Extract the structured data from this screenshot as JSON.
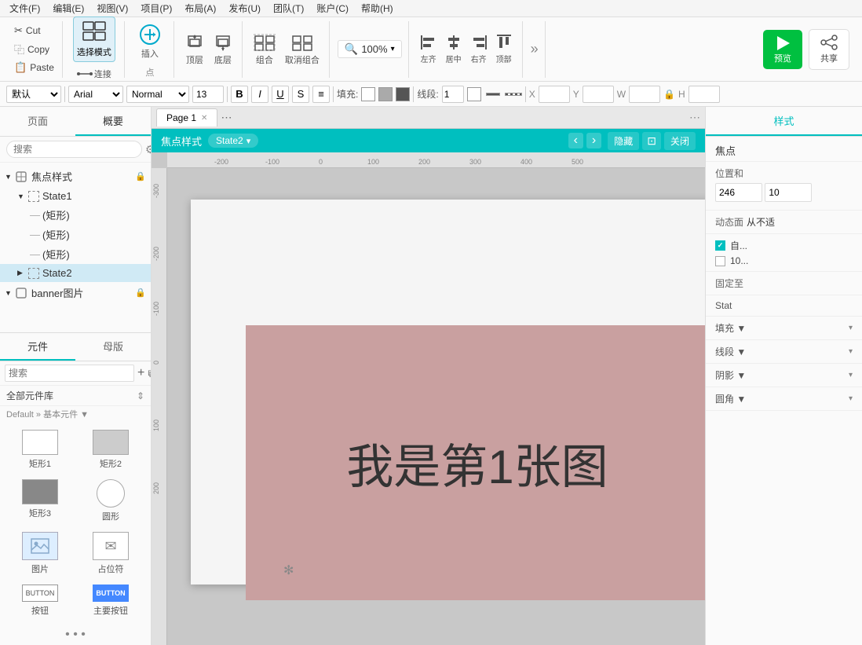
{
  "menubar": {
    "items": [
      "文件(F)",
      "编辑(E)",
      "视图(V)",
      "项目(P)",
      "布局(A)",
      "发布(U)",
      "团队(T)",
      "账户(C)",
      "帮助(H)"
    ]
  },
  "toolbar": {
    "cut_label": "Cut",
    "copy_label": "Copy",
    "paste_label": "Paste",
    "select_mode_label": "选择模式",
    "connect_label": "连接",
    "insert_label": "插入",
    "point_label": "点",
    "top_label": "顶层",
    "bottom_label": "底层",
    "group_label": "组合",
    "ungroup_label": "取消组合",
    "zoom_value": "100%",
    "left_align_label": "左齐",
    "center_align_label": "居中",
    "right_align_label": "右齐",
    "top_align_label": "顶部",
    "preview_label": "预览",
    "share_label": "共享",
    "more_label": "..."
  },
  "formatbar": {
    "style_label": "默认",
    "font_label": "Arial",
    "weight_label": "Normal",
    "size_label": "13",
    "bold_label": "B",
    "italic_label": "I",
    "underline_label": "U",
    "strikethrough_label": "S",
    "list_label": "≡",
    "fill_label": "填充:",
    "stroke_label": "线段:",
    "stroke_value": "1",
    "x_label": "X",
    "y_label": "Y",
    "w_label": "W",
    "h_label": "H"
  },
  "left_panel": {
    "tab_page_label": "页面",
    "tab_overview_label": "概要",
    "search_placeholder": "搜索",
    "layers": [
      {
        "id": "focus-style",
        "label": "焦点样式",
        "indent": 0,
        "expanded": true,
        "type": "component",
        "selected": false
      },
      {
        "id": "state1",
        "label": "State1",
        "indent": 1,
        "expanded": true,
        "type": "state",
        "selected": false
      },
      {
        "id": "rect1",
        "label": "(矩形)",
        "indent": 2,
        "expanded": false,
        "type": "rect",
        "selected": false
      },
      {
        "id": "rect2",
        "label": "(矩形)",
        "indent": 2,
        "expanded": false,
        "type": "rect",
        "selected": false
      },
      {
        "id": "rect3",
        "label": "(矩形)",
        "indent": 2,
        "expanded": false,
        "type": "rect",
        "selected": false
      },
      {
        "id": "state2",
        "label": "State2",
        "indent": 1,
        "expanded": false,
        "type": "state",
        "selected": true
      },
      {
        "id": "banner",
        "label": "banner图片",
        "indent": 0,
        "expanded": true,
        "type": "component",
        "selected": false
      }
    ]
  },
  "component_panel": {
    "tab_component_label": "元件",
    "tab_master_label": "母版",
    "search_placeholder": "搜索",
    "library_title": "全部元件库",
    "source_label": "Default » 基本元件 ▼",
    "components": [
      {
        "id": "rect1",
        "label": "矩形1",
        "shape": "rect1"
      },
      {
        "id": "rect2",
        "label": "矩形2",
        "shape": "rect2"
      },
      {
        "id": "rect3",
        "label": "矩形3",
        "shape": "rect3"
      },
      {
        "id": "circle",
        "label": "圆形",
        "shape": "circle"
      },
      {
        "id": "image",
        "label": "图片",
        "shape": "image"
      },
      {
        "id": "placeholder",
        "label": "占位符",
        "shape": "placeholder"
      },
      {
        "id": "button",
        "label": "按钮",
        "shape": "button"
      },
      {
        "id": "main-button",
        "label": "主要按钮",
        "shape": "main-button"
      }
    ]
  },
  "canvas": {
    "page_tab_label": "Page 1",
    "focus_bar_title": "焦点样式",
    "focus_bar_state": "State2",
    "focus_bar_state_arrow": "▾",
    "focus_bar_prev": "‹",
    "focus_bar_next": "›",
    "focus_bar_hide": "隐藏",
    "focus_bar_expand": "⊡",
    "focus_bar_close": "关闭",
    "element_text": "我是第1张图",
    "ruler_marks_h": [
      "-200",
      "-100",
      "0",
      "100",
      "200",
      "300",
      "400",
      "500"
    ],
    "ruler_marks_v": [
      "-300",
      "-200",
      "-100",
      "0",
      "100",
      "200"
    ]
  },
  "right_panel": {
    "tab_style_label": "样式",
    "section_focus": "焦点",
    "section_position": "位置和",
    "position_value": "246",
    "second_value": "10",
    "animation_label": "动态面",
    "animation_value": "从不适",
    "checkbox1_label": "自...",
    "checkbox1_checked": true,
    "checkbox2_label": "10...",
    "checkbox2_checked": false,
    "fixed_label": "固定至",
    "state_section_label": "Stat",
    "fill_label": "填充 ▼",
    "stroke_label": "线段 ▼",
    "shadow_label": "阴影 ▼",
    "corner_label": "圆角 ▼"
  }
}
